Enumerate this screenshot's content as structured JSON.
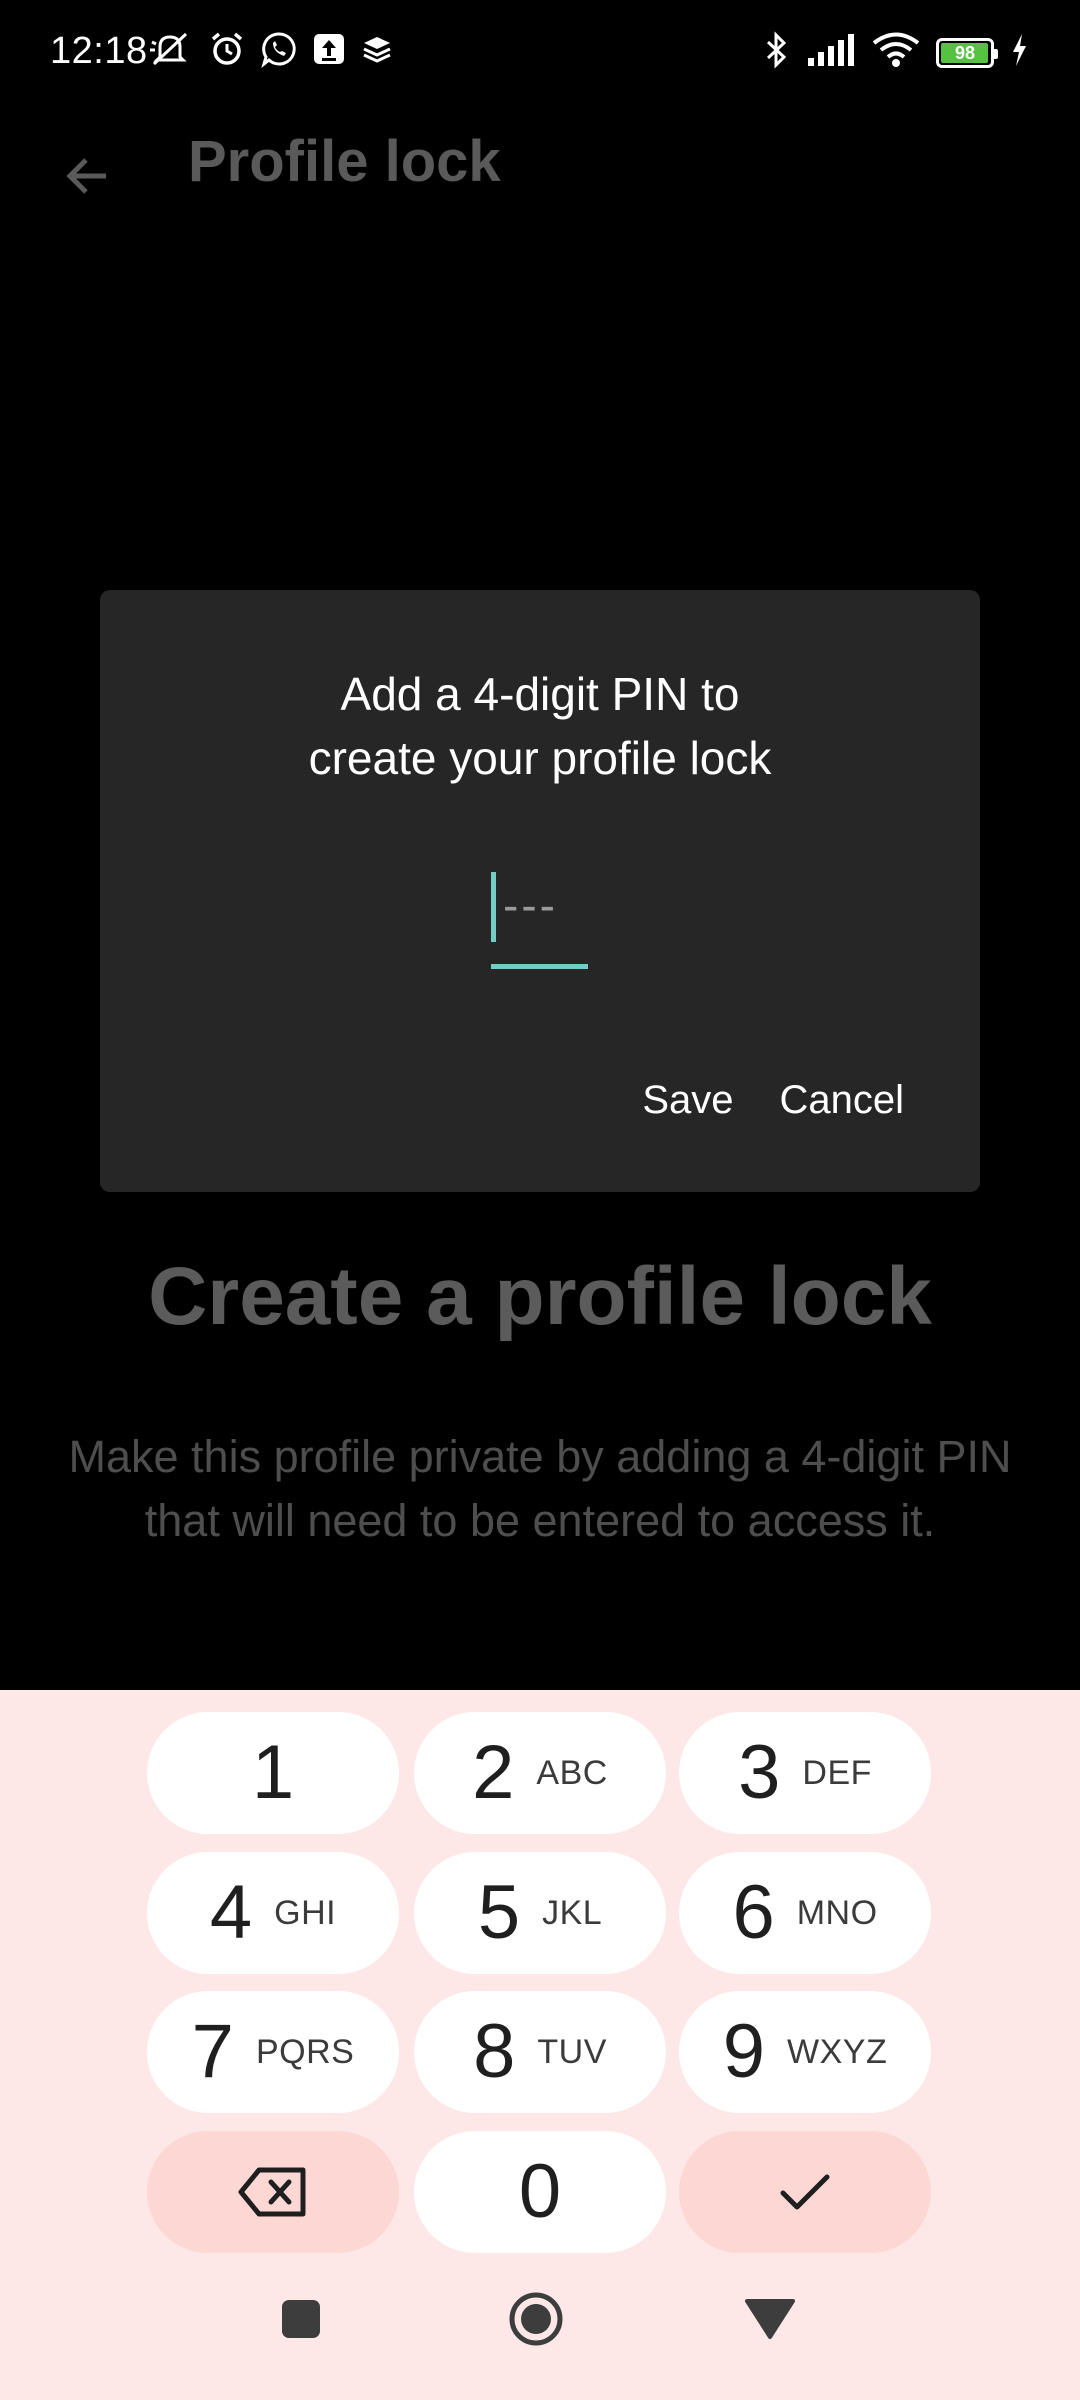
{
  "status_bar": {
    "time": "12:18",
    "battery_level": "98",
    "battery_fraction": 0.98,
    "left_icons": [
      "muted-bell-icon",
      "alarm-icon",
      "whatsapp-icon",
      "upload-icon",
      "layers-icon"
    ],
    "right_icons": [
      "bluetooth-icon",
      "signal-icon",
      "wifi-icon",
      "battery-icon",
      "charging-icon"
    ]
  },
  "app_bar": {
    "title": "Profile lock",
    "back_icon": "arrow-left-icon"
  },
  "background": {
    "heading": "Create a profile lock",
    "description": "Make this profile private by adding a 4-digit PIN that will need to be entered to access it."
  },
  "dialog": {
    "title_line1": "Add a 4-digit PIN to",
    "title_line2": "create your profile lock",
    "pin_placeholder": "---",
    "pin_value": "",
    "save_label": "Save",
    "cancel_label": "Cancel"
  },
  "keypad": {
    "keys": [
      {
        "digit": "1",
        "letters": ""
      },
      {
        "digit": "2",
        "letters": "ABC"
      },
      {
        "digit": "3",
        "letters": "DEF"
      },
      {
        "digit": "4",
        "letters": "GHI"
      },
      {
        "digit": "5",
        "letters": "JKL"
      },
      {
        "digit": "6",
        "letters": "MNO"
      },
      {
        "digit": "7",
        "letters": "PQRS"
      },
      {
        "digit": "8",
        "letters": "TUV"
      },
      {
        "digit": "9",
        "letters": "WXYZ"
      },
      {
        "digit": "0",
        "letters": ""
      }
    ],
    "backspace_icon": "backspace-icon",
    "done_icon": "checkmark-icon"
  },
  "nav_bar": {
    "icons": [
      "square-recents-icon",
      "circle-home-icon",
      "triangle-back-icon"
    ]
  },
  "colors": {
    "accent": "#74ccc6",
    "dialog_bg": "#262626",
    "keypad_bg": "#fde8e7",
    "key_special_bg": "#fdd7d4"
  }
}
